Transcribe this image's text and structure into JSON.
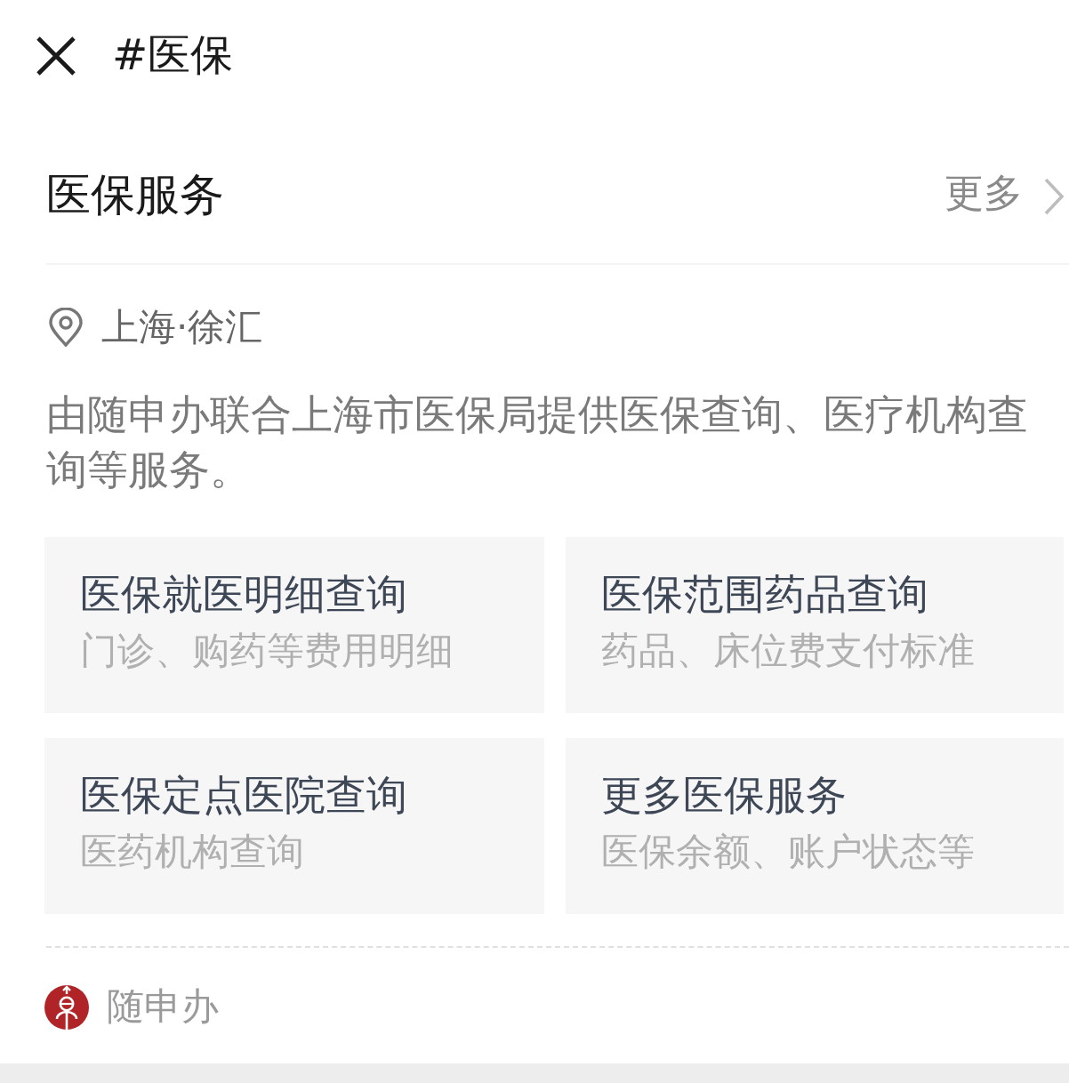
{
  "header": {
    "title": "#医保"
  },
  "section": {
    "title": "医保服务",
    "more_link": "更多"
  },
  "location": "上海·徐汇",
  "description": "由随申办联合上海市医保局提供医保查询、医疗机构查询等服务。",
  "services": [
    {
      "title": "医保就医明细查询",
      "subtitle": "门诊、购药等费用明细"
    },
    {
      "title": "医保范围药品查询",
      "subtitle": "药品、床位费支付标准"
    },
    {
      "title": "医保定点医院查询",
      "subtitle": "医药机构查询"
    },
    {
      "title": "更多医保服务",
      "subtitle": "医保余额、账户状态等"
    }
  ],
  "footer": {
    "source": "随申办"
  }
}
